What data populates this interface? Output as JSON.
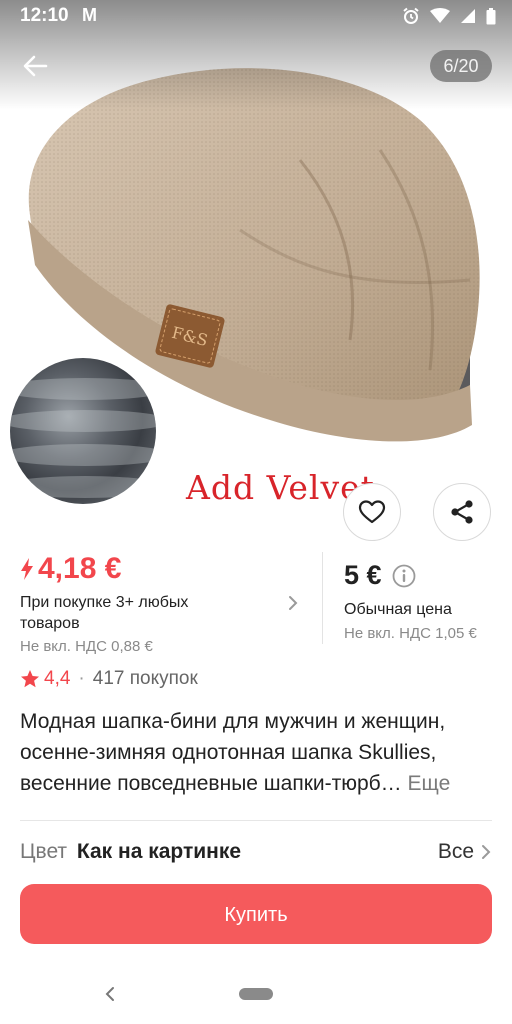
{
  "status_bar": {
    "time": "12:10",
    "mail_badge": "M"
  },
  "gallery": {
    "counter": "6/20",
    "overlay_text": "Add Velvet",
    "patch_text": "F&S"
  },
  "price": {
    "sale_price": "4,18 €",
    "promo_text": "При покупке 3+ любых товаров",
    "vat_sale": "Не вкл. НДС 0,88 €",
    "regular_price": "5 €",
    "regular_label": "Обычная цена",
    "vat_regular": "Не вкл. НДС 1,05 €"
  },
  "rating": {
    "value": "4,4",
    "separator": "·",
    "purchases": "417 покупок"
  },
  "description": {
    "text": "Модная шапка-бини для мужчин и женщин, осенне-зимняя однотонная шапка Skullies, весенние повседневные шапки-тюрб…",
    "more_label": "Еще"
  },
  "color": {
    "label": "Цвет",
    "value": "Как на картинке",
    "all_label": "Все"
  },
  "buy_button": "Купить",
  "colors": {
    "accent": "#f2464c",
    "buy_button": "#f55a5c",
    "hat": "#c9b6a0",
    "overlay_text": "#d8242a"
  },
  "icons": [
    "back-arrow-icon",
    "heart-icon",
    "share-icon",
    "lightning-icon",
    "chevron-right-icon",
    "info-icon",
    "star-icon"
  ]
}
